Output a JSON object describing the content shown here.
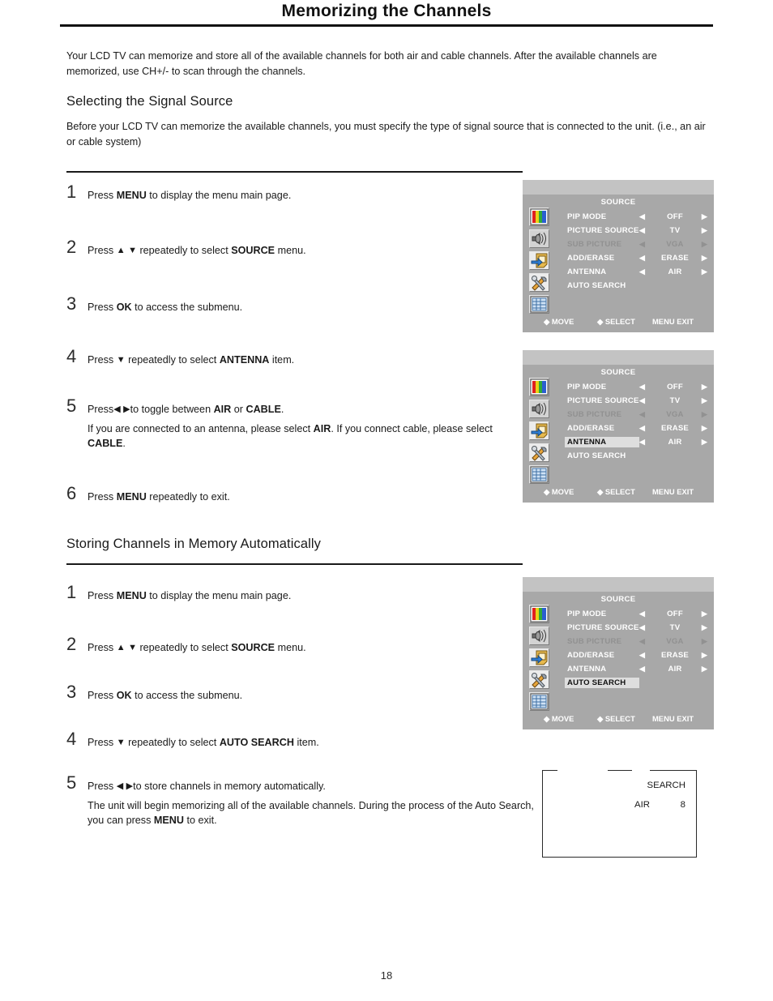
{
  "page": {
    "title": "Memorizing the Channels",
    "number": "18",
    "intro": "Your LCD TV can memorize and store all of the available channels for both air and cable channels. After the  available channels are memorized, use CH+/- to scan through the channels."
  },
  "sections": [
    {
      "heading": "Selecting the Signal Source",
      "intro": "Before your LCD TV can memorize the available channels, you must specify the type of signal  source that is connected to the unit. (i.e., an air or cable system)",
      "steps": [
        {
          "num": "1",
          "text_pre": "Press ",
          "bold1": "MENU",
          "text_post": " to display the menu main page."
        },
        {
          "num": "2",
          "text_pre": "Press ",
          "arrows": "up-down",
          "text_mid": " repeatedly to select ",
          "bold1": "SOURCE",
          "text_post": " menu."
        },
        {
          "num": "3",
          "text_pre": "Press ",
          "bold1": "OK",
          "text_post": " to access the submenu."
        },
        {
          "num": "4",
          "text_pre": "Press ",
          "arrows": "down",
          "text_mid": " repeatedly to select ",
          "bold1": "ANTENNA",
          "text_post": " item."
        },
        {
          "num": "5",
          "text_pre": "Press",
          "arrows": "left-right",
          "text_mid": "to toggle between ",
          "bold1": "AIR",
          "text_mid2": " or ",
          "bold2": "CABLE",
          "text_post": ".",
          "sub_pre": "If you are connected to an antenna, please select ",
          "sub_b1": "AIR",
          "sub_mid": ". If you connect cable, please select ",
          "sub_b2": "CABLE",
          "sub_post": "."
        },
        {
          "num": "6",
          "text_pre": "Press ",
          "bold1": "MENU",
          "text_post": " repeatedly to exit."
        }
      ]
    },
    {
      "heading": "Storing Channels in Memory Automatically",
      "steps": [
        {
          "num": "1",
          "text_pre": "Press ",
          "bold1": "MENU",
          "text_post": " to display the menu main page."
        },
        {
          "num": "2",
          "text_pre": "Press ",
          "arrows": "up-down",
          "text_mid": " repeatedly to select ",
          "bold1": "SOURCE",
          "text_post": " menu."
        },
        {
          "num": "3",
          "text_pre": "Press ",
          "bold1": "OK",
          "text_post": " to access the submenu."
        },
        {
          "num": "4",
          "text_pre": "Press ",
          "arrows": "down",
          "text_mid": " repeatedly to select ",
          "bold1": "AUTO SEARCH",
          "text_post": " item."
        },
        {
          "num": "5",
          "text_pre": "Press ",
          "arrows": "left-right",
          "text_mid": "to store channels in memory automatically.",
          "text_post": "",
          "sub_pre": "The unit will begin memorizing all of the available channels. During the process of the Auto Search, you can press ",
          "sub_b1": "MENU",
          "sub_mid": " to exit.",
          "sub_b2": "",
          "sub_post": ""
        }
      ]
    }
  ],
  "osd": {
    "title": "SOURCE",
    "icons": [
      {
        "name": "picture-icon"
      },
      {
        "name": "sound-icon"
      },
      {
        "name": "source-icon"
      },
      {
        "name": "tools-icon"
      },
      {
        "name": "setup-icon"
      }
    ],
    "footer": {
      "move": "◆ MOVE",
      "select": "◆ SELECT",
      "menu_exit": "MENU EXIT"
    },
    "panels": [
      {
        "id": "panel-step1",
        "selected": null,
        "rows": [
          {
            "label": "PIP MODE",
            "value": "OFF",
            "has_arrows": true,
            "dim": false
          },
          {
            "label": "PICTURE SOURCE",
            "value": "TV",
            "has_arrows": true,
            "dim": false
          },
          {
            "label": "SUB PICTURE",
            "value": "VGA",
            "has_arrows": true,
            "dim": true
          },
          {
            "label": "ADD/ERASE",
            "value": "ERASE",
            "has_arrows": true,
            "dim": false
          },
          {
            "label": "ANTENNA",
            "value": "AIR",
            "has_arrows": true,
            "dim": false
          },
          {
            "label": "AUTO SEARCH",
            "value": "",
            "has_arrows": false,
            "dim": false
          }
        ]
      },
      {
        "id": "panel-antenna",
        "selected": "ANTENNA",
        "rows": [
          {
            "label": "PIP MODE",
            "value": "OFF",
            "has_arrows": true,
            "dim": false
          },
          {
            "label": "PICTURE SOURCE",
            "value": "TV",
            "has_arrows": true,
            "dim": false
          },
          {
            "label": "SUB PICTURE",
            "value": "VGA",
            "has_arrows": true,
            "dim": true
          },
          {
            "label": "ADD/ERASE",
            "value": "ERASE",
            "has_arrows": true,
            "dim": false
          },
          {
            "label": "ANTENNA",
            "value": "AIR",
            "has_arrows": true,
            "dim": false
          },
          {
            "label": "AUTO SEARCH",
            "value": "",
            "has_arrows": false,
            "dim": false
          }
        ]
      },
      {
        "id": "panel-autosearch",
        "selected": "AUTO SEARCH",
        "rows": [
          {
            "label": "PIP MODE",
            "value": "OFF",
            "has_arrows": true,
            "dim": false
          },
          {
            "label": "PICTURE SOURCE",
            "value": "TV",
            "has_arrows": true,
            "dim": false
          },
          {
            "label": "SUB PICTURE",
            "value": "VGA",
            "has_arrows": true,
            "dim": true
          },
          {
            "label": "ADD/ERASE",
            "value": "ERASE",
            "has_arrows": true,
            "dim": false
          },
          {
            "label": "ANTENNA",
            "value": "AIR",
            "has_arrows": true,
            "dim": false
          },
          {
            "label": "AUTO SEARCH",
            "value": "",
            "has_arrows": false,
            "dim": false
          }
        ]
      }
    ]
  },
  "search_overlay": {
    "title": "SEARCH",
    "band": "AIR",
    "channel": "8"
  },
  "colors": {
    "osd_bg": "#a8a8a8",
    "osd_topband": "#c3c3c3",
    "osd_text": "#ffffff",
    "osd_dim_text": "#919191",
    "osd_highlight_bg": "#dedede",
    "osd_highlight_text": "#111111",
    "page_text": "#1a1a1a"
  }
}
